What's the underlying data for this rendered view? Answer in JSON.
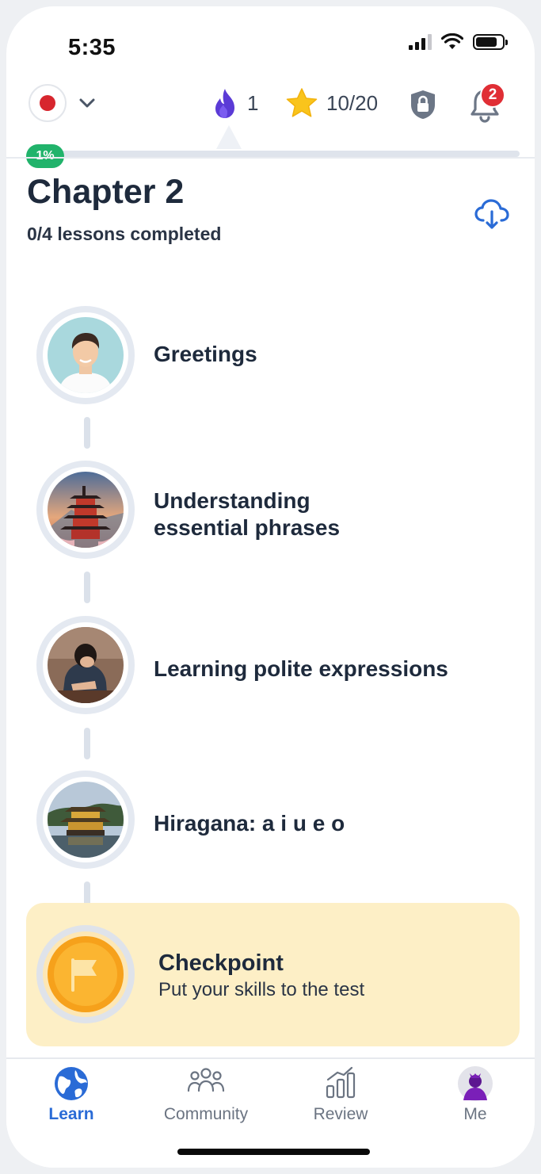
{
  "status_bar": {
    "time": "5:35"
  },
  "top_bar": {
    "language": "Japanese",
    "streak": "1",
    "stars": "10/20",
    "notifications_count": "2"
  },
  "progress": {
    "label": "1%",
    "value": 0.01
  },
  "chapter": {
    "title": "Chapter 2",
    "subtitle": "0/4 lessons completed"
  },
  "lessons": [
    {
      "title": "Greetings",
      "icon": "person-portrait"
    },
    {
      "title_lines": [
        "Understanding",
        "essential phrases"
      ],
      "icon": "pagoda-photo"
    },
    {
      "title": "Learning polite expressions",
      "icon": "bowing-person-photo"
    },
    {
      "title": "Hiragana: a i u e o",
      "icon": "golden-pavilion-photo"
    }
  ],
  "checkpoint": {
    "title": "Checkpoint",
    "subtitle": "Put your skills to the test",
    "icon": "flag-coin-icon"
  },
  "nav": {
    "items": [
      {
        "label": "Learn",
        "icon": "globe-icon",
        "active": true
      },
      {
        "label": "Community",
        "icon": "people-icon",
        "active": false
      },
      {
        "label": "Review",
        "icon": "bar-chart-icon",
        "active": false
      },
      {
        "label": "Me",
        "icon": "avatar-icon",
        "active": false
      }
    ]
  },
  "colors": {
    "accent_blue": "#2a6bd6",
    "progress_green": "#21b36b",
    "checkpoint_bg": "#fdefc6",
    "streak_purple": "#5b3bd6",
    "star_yellow": "#f9c41c",
    "badge_red": "#e02e35"
  }
}
